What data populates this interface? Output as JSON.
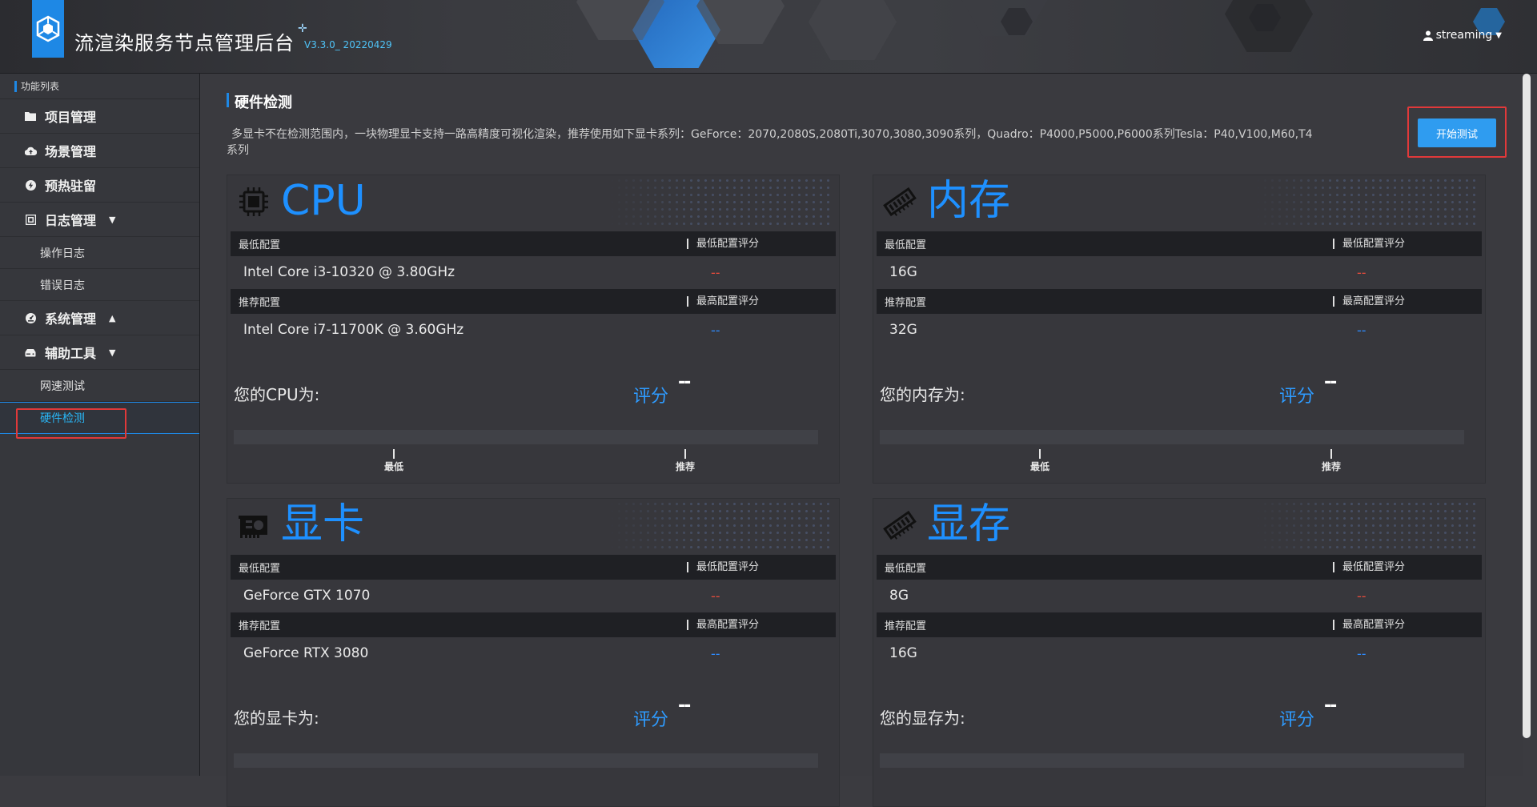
{
  "header": {
    "title": "流渲染服务节点管理后台",
    "version": "V3.3.0_ 20220429",
    "user": "streaming"
  },
  "sidebar": {
    "heading": "功能列表",
    "items": [
      {
        "label": "项目管理",
        "icon": "folder-icon"
      },
      {
        "label": "场景管理",
        "icon": "cloud-upload-icon"
      },
      {
        "label": "预热驻留",
        "icon": "bolt-icon"
      },
      {
        "label": "日志管理",
        "icon": "log-icon",
        "caret": "down",
        "children": [
          "操作日志",
          "错误日志"
        ]
      },
      {
        "label": "系统管理",
        "icon": "dashboard-icon",
        "caret": "up"
      },
      {
        "label": "辅助工具",
        "icon": "tool-icon",
        "caret": "down",
        "children": [
          "网速测试",
          "硬件检测"
        ]
      }
    ]
  },
  "main": {
    "title": "硬件检测",
    "description": "多显卡不在检测范围内，一块物理显卡支持一路高精度可视化渲染，推荐使用如下显卡系列：GeForce：2070,2080S,2080Ti,3070,3080,3090系列，Quadro：P4000,P5000,P6000系列Tesla：P40,V100,M60,T4系列",
    "start_button": "开始测试",
    "labels": {
      "min_config": "最低配置",
      "min_score": "最低配置评分",
      "rec_config": "推荐配置",
      "max_score": "最高配置评分",
      "score": "评分",
      "tick_min": "最低",
      "tick_rec": "推荐",
      "dash": "--",
      "score_value": "--"
    },
    "cards": {
      "cpu": {
        "title": "CPU",
        "min": "Intel Core i3-10320 @ 3.80GHz",
        "rec": "Intel Core i7-11700K @ 3.60GHz",
        "yours": "您的CPU为:"
      },
      "mem": {
        "title": "内存",
        "min": "16G",
        "rec": "32G",
        "yours": "您的内存为:"
      },
      "gpu": {
        "title": "显卡",
        "min": "GeForce GTX 1070",
        "rec": "GeForce RTX 3080",
        "yours": "您的显卡为:"
      },
      "vram": {
        "title": "显存",
        "min": "8G",
        "rec": "16G",
        "yours": "您的显存为:"
      }
    }
  }
}
